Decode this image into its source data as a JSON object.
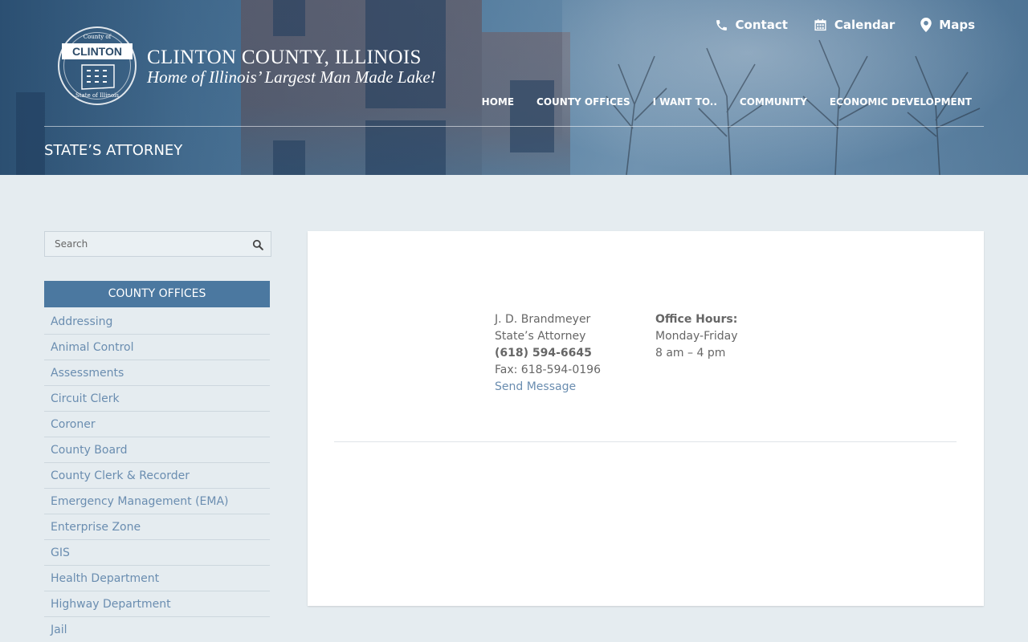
{
  "site": {
    "title": "CLINTON COUNTY, ILLINOIS",
    "tagline": "Home of Illinois’ Largest Man Made Lake!",
    "seal": {
      "top_text": "County of",
      "banner": "CLINTON",
      "bottom_text": "State of Illinois"
    }
  },
  "utility_nav": [
    {
      "label": "Contact",
      "icon": "phone-icon"
    },
    {
      "label": "Calendar",
      "icon": "calendar-icon"
    },
    {
      "label": "Maps",
      "icon": "map-pin-icon"
    }
  ],
  "main_nav": [
    "HOME",
    "COUNTY OFFICES",
    "I WANT TO..",
    "COMMUNITY",
    "ECONOMIC DEVELOPMENT"
  ],
  "page": {
    "title": "STATE’S ATTORNEY"
  },
  "search": {
    "placeholder": "Search",
    "icon": "search-icon"
  },
  "sidebar": {
    "heading": "COUNTY OFFICES",
    "items": [
      "Addressing",
      "Animal Control",
      "Assessments",
      "Circuit Clerk",
      "Coroner",
      "County Board",
      "County Clerk & Recorder",
      "Emergency Management (EMA)",
      "Enterprise Zone",
      "GIS",
      "Health Department",
      "Highway Department",
      "Jail"
    ]
  },
  "contact": {
    "name": "J. D. Brandmeyer",
    "role": "State’s Attorney",
    "phone": "(618) 594-6645",
    "fax": "Fax: 618-594-0196",
    "message_link": "Send Message"
  },
  "hours": {
    "label": "Office Hours:",
    "days": "Monday-Friday",
    "time": "8 am – 4 pm"
  },
  "colors": {
    "accent": "#4b78a0",
    "link": "#6a8db0",
    "page_bg": "#e5ecf0"
  }
}
